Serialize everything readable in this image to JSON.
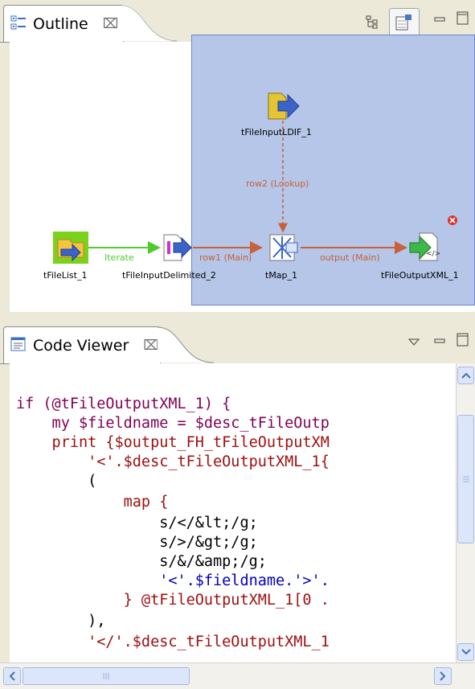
{
  "outline": {
    "tab_label": "Outline",
    "close_glyph": "⌧",
    "nodes": [
      {
        "label": "tFileList_1"
      },
      {
        "label": "tFileInputDelimited_2"
      },
      {
        "label": "tFileInputLDIF_1"
      },
      {
        "label": "tMap_1"
      },
      {
        "label": "tFileOutputXML_1"
      }
    ],
    "links": [
      {
        "label": "Iterate"
      },
      {
        "label": "row1 (Main)"
      },
      {
        "label": "row2 (Lookup)"
      },
      {
        "label": "output (Main)"
      }
    ]
  },
  "code_viewer": {
    "tab_label": "Code Viewer",
    "close_glyph": "⌧",
    "lines": [
      "if (@tFileOutputXML_1) {",
      "    my $fieldname = $desc_tFileOutp",
      "    print {$output_FH_tFileOutputXM",
      "        '<'.$desc_tFileOutputXML_1{",
      "        (",
      "            map {",
      "                s/</&lt;/g;",
      "                s/>/&gt;/g;",
      "                s/&/&amp;/g;",
      "                '<'.$fieldname.'>'.",
      "            } @tFileOutputXML_1[0 .",
      "        ),",
      "        '</'.$desc_tFileOutputXML_1"
    ]
  },
  "colors": {
    "selection": "#b5c6e8",
    "keyword": "#7f0055",
    "string": "#0000c0"
  }
}
